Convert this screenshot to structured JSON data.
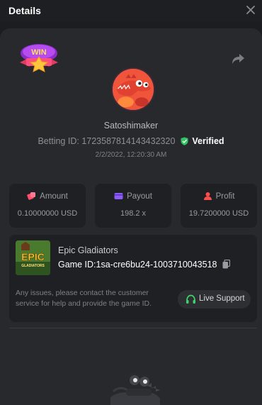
{
  "header": {
    "title": "Details",
    "close_icon": "close-icon"
  },
  "badge": {
    "text": "WIN"
  },
  "user": {
    "username": "Satoshimaker",
    "betting_id_label": "Betting ID:",
    "betting_id": "1723587814143432320",
    "verified": "Verified",
    "date": "2/2/2022, 12:20:30 AM"
  },
  "stats": [
    {
      "label": "Amount",
      "value": "0.10000000 USD",
      "icon": "dice-icon",
      "color": "#ff4d6a"
    },
    {
      "label": "Payout",
      "value": "198.2 x",
      "icon": "wallet-icon",
      "color": "#8b5cf6"
    },
    {
      "label": "Profit",
      "value": "19.7200000 USD",
      "icon": "user-coin-icon",
      "color": "#ff4d4d"
    }
  ],
  "game": {
    "name": "Epic Gladiators",
    "id_label": "Game ID:",
    "id": "1sa-cre6bu24-1003710043518",
    "thumb_text": "EPIC",
    "thumb_sub": "GLADIATORS"
  },
  "support": {
    "message": "Any issues, please contact the customer service for help and provide the game ID.",
    "button_label": "Live Support"
  },
  "colors": {
    "verified": "#2ec55e",
    "accent_green": "#3fd26a",
    "background": "#1c1d20",
    "panel": "#28292d"
  }
}
